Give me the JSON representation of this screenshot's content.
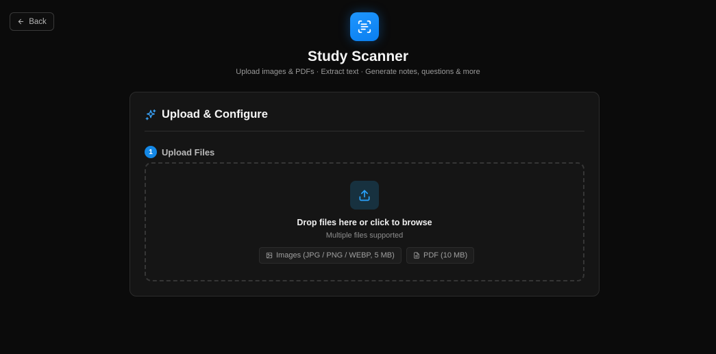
{
  "back": {
    "label": "Back"
  },
  "header": {
    "title": "Study Scanner",
    "subtitle": "Upload images & PDFs · Extract text · Generate notes, questions & more"
  },
  "card": {
    "title": "Upload & Configure",
    "step": {
      "number": "1",
      "label": "Upload Files"
    },
    "dropzone": {
      "title": "Drop files here or click to browse",
      "subtitle": "Multiple files supported",
      "chips": [
        {
          "icon": "image-icon",
          "label": "Images (JPG / PNG / WEBP, 5 MB)"
        },
        {
          "icon": "file-icon",
          "label": "PDF (10 MB)"
        }
      ]
    }
  },
  "colors": {
    "accent": "#1488e6",
    "background": "#0b0b0b",
    "card": "#151515"
  }
}
